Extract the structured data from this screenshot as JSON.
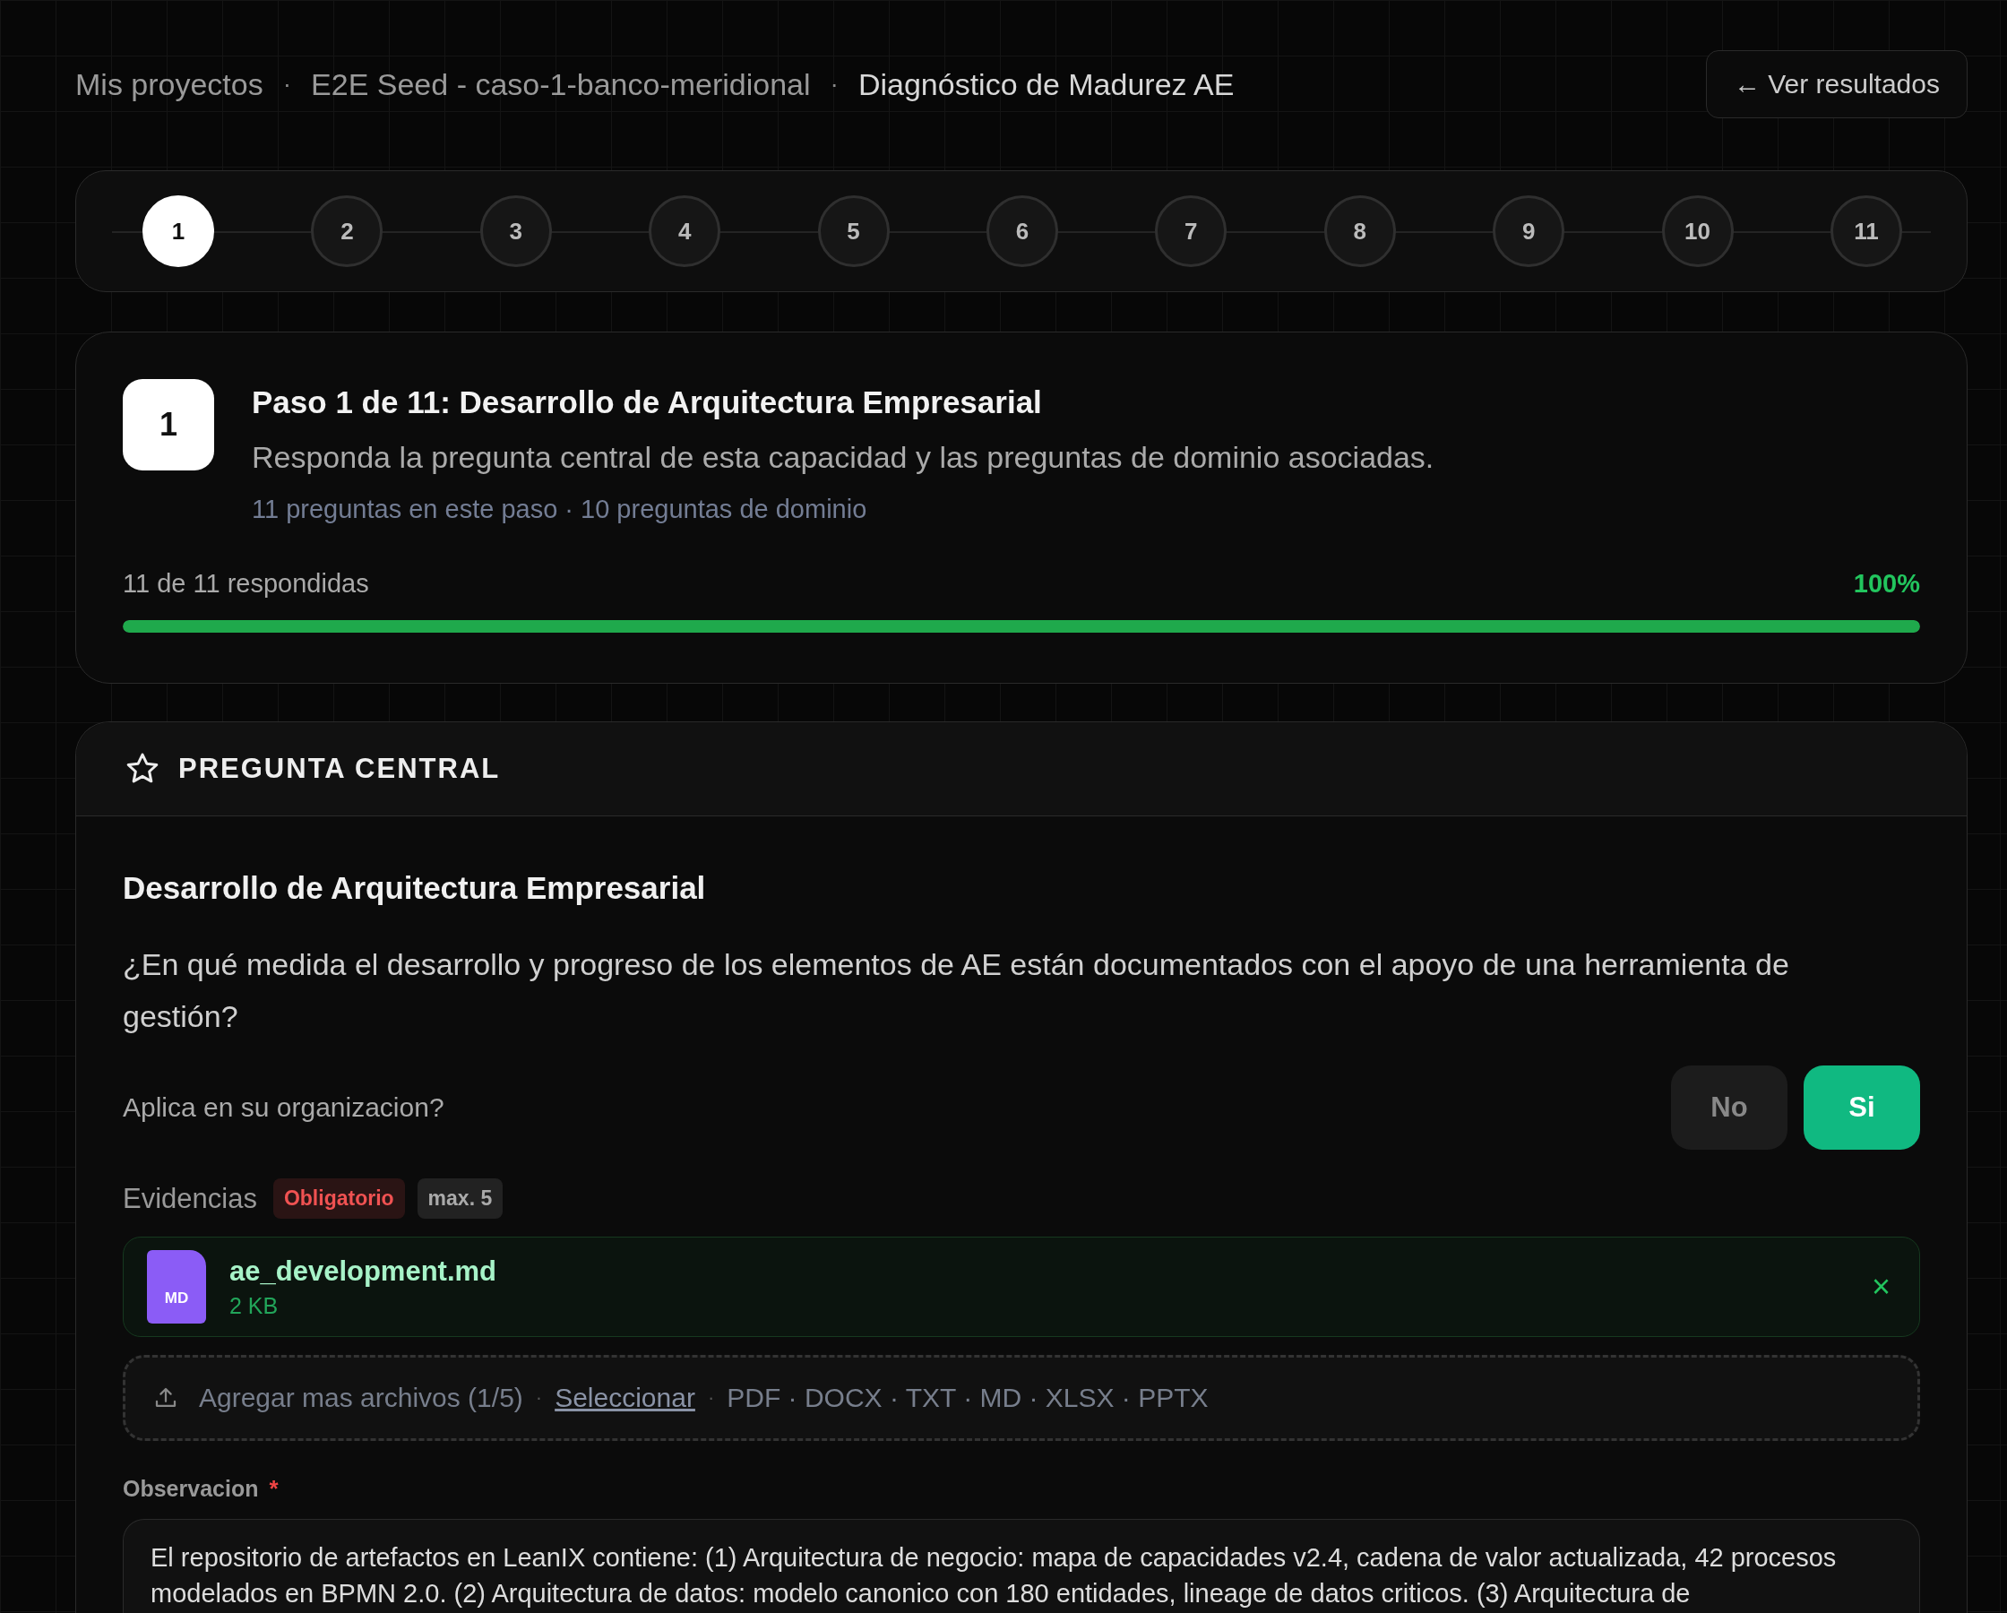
{
  "breadcrumb": {
    "separator": "·",
    "items": [
      {
        "label": "Mis proyectos",
        "current": false
      },
      {
        "label": "E2E Seed - caso-1-banco-meridional",
        "current": false
      },
      {
        "label": "Diagnóstico de Madurez AE",
        "current": true
      }
    ]
  },
  "back_button": {
    "label": "← Ver resultados"
  },
  "stepper": {
    "steps": [
      {
        "label": "1",
        "selected": true
      },
      {
        "label": "2",
        "selected": false
      },
      {
        "label": "3",
        "selected": false
      },
      {
        "label": "4",
        "selected": false
      },
      {
        "label": "5",
        "selected": false
      },
      {
        "label": "6",
        "selected": false
      },
      {
        "label": "7",
        "selected": false
      },
      {
        "label": "8",
        "selected": false
      },
      {
        "label": "9",
        "selected": false
      },
      {
        "label": "10",
        "selected": false
      },
      {
        "label": "11",
        "selected": false
      }
    ]
  },
  "step": {
    "badge": "1",
    "title": "Paso 1 de 11: Desarrollo de Arquitectura Empresarial",
    "subtitle": "Responda la pregunta central de esta capacidad y las preguntas de dominio asociadas.",
    "meta": "11 preguntas en este paso · 10 preguntas de dominio",
    "progress_label": "11 de 11 respondidas",
    "percent": "100%",
    "level": 1
  },
  "question": {
    "header": "PREGUNTA CENTRAL",
    "title": "Desarrollo de Arquitectura Empresarial",
    "text": "¿En qué medida el desarrollo y progreso de los elementos de AE están documentados con el apoyo de una herramienta de gestión?",
    "applies": {
      "label": "Aplica en su organizacion?",
      "options": [
        {
          "label": "No",
          "selected": false
        },
        {
          "label": "Si",
          "selected": true
        }
      ]
    },
    "evidence": {
      "label": "Evidencias",
      "badges": [
        {
          "kind": "required",
          "text": "Obligatorio"
        },
        {
          "kind": "limit",
          "text": "max. 5"
        }
      ],
      "files": [
        {
          "type": "MD",
          "name": "ae_development.md",
          "size": "2 KB",
          "remove": "×"
        }
      ],
      "dropzone": {
        "text": "Agregar mas archivos (1/5)",
        "separator": "·",
        "link": "Seleccionar",
        "formats": "PDF · DOCX · TXT · MD · XLSX · PPTX"
      }
    },
    "observation": {
      "label": "Observacion",
      "required": true,
      "required_mark": "*",
      "value": "El repositorio de artefactos en LeanIX contiene: (1) Arquitectura de negocio: mapa de capacidades v2.4, cadena de valor actualizada, 42 procesos modelados en BPMN 2.0. (2) Arquitectura de datos: modelo canonico con 180 entidades, lineage de datos criticos. (3) Arquitectura de"
    }
  }
}
